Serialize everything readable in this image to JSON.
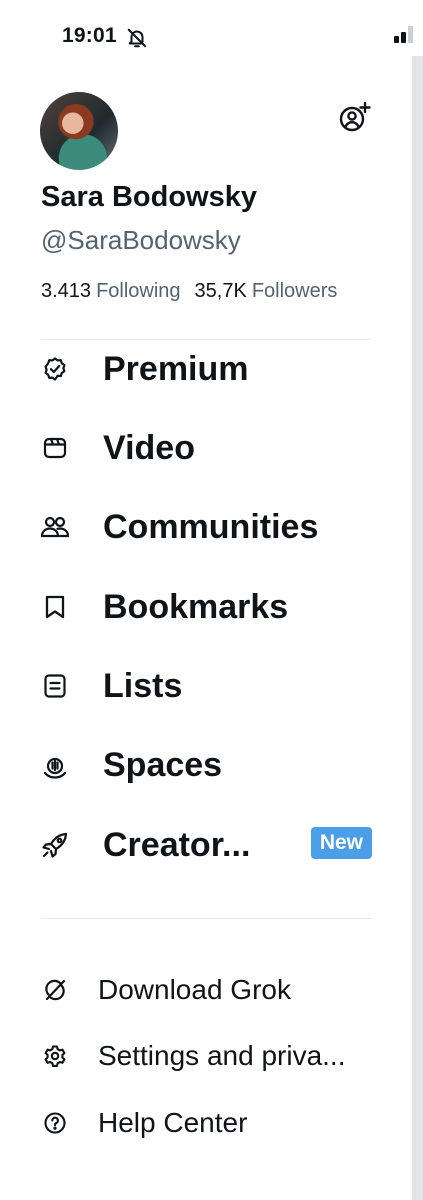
{
  "status_bar": {
    "time": "19:01"
  },
  "profile": {
    "name": "Sara Bodowsky",
    "handle": "@SaraBodowsky",
    "following_count": "3.413",
    "following_label": "Following",
    "followers_count": "35,7K",
    "followers_label": "Followers"
  },
  "nav": {
    "items": [
      {
        "label": "Premium",
        "icon": "verified-badge-icon"
      },
      {
        "label": "Video",
        "icon": "video-icon"
      },
      {
        "label": "Communities",
        "icon": "communities-icon"
      },
      {
        "label": "Bookmarks",
        "icon": "bookmark-icon"
      },
      {
        "label": "Lists",
        "icon": "lists-icon"
      },
      {
        "label": "Spaces",
        "icon": "spaces-icon"
      },
      {
        "label": "Creator...",
        "icon": "rocket-icon",
        "badge": "New"
      }
    ]
  },
  "secondary": {
    "items": [
      {
        "label": "Download Grok",
        "icon": "grok-icon"
      },
      {
        "label": "Settings and priva...",
        "icon": "gear-icon"
      },
      {
        "label": "Help Center",
        "icon": "help-icon"
      }
    ]
  },
  "colors": {
    "text": "#0f1419",
    "muted": "#536471",
    "badge": "#4b9ee8",
    "divider": "#e5e9ec"
  }
}
